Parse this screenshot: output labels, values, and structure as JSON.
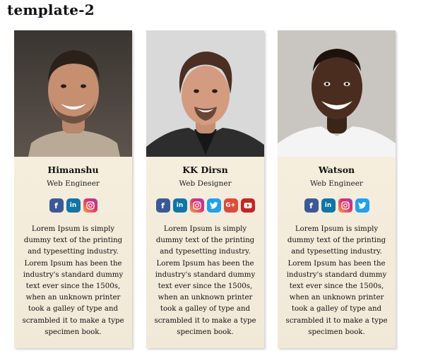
{
  "page": {
    "title": "template-2"
  },
  "cards": [
    {
      "name": "Himanshu",
      "role": "Web Engineer",
      "socials": [
        "facebook-icon",
        "linkedin-icon",
        "instagram-icon"
      ],
      "bio": "Lorem Ipsum is simply dummy text of the printing and typesetting industry. Lorem Ipsum has been the industry's standard dummy text ever since the 1500s, when an unknown printer took a galley of type and scrambled it to make a type specimen book."
    },
    {
      "name": "KK Dirsn",
      "role": "Web Designer",
      "socials": [
        "facebook-icon",
        "linkedin-icon",
        "instagram-icon",
        "twitter-icon",
        "google-plus-icon",
        "youtube-icon"
      ],
      "bio": "Lorem Ipsum is simply dummy text of the printing and typesetting industry. Lorem Ipsum has been the industry's standard dummy text ever since the 1500s, when an unknown printer took a galley of type and scrambled it to make a type specimen book."
    },
    {
      "name": "Watson",
      "role": "Web Engineer",
      "socials": [
        "facebook-icon",
        "linkedin-icon",
        "instagram-icon",
        "twitter-icon"
      ],
      "bio": "Lorem Ipsum is simply dummy text of the printing and typesetting industry. Lorem Ipsum has been the industry's standard dummy text ever since the 1500s, when an unknown printer took a galley of type and scrambled it to make a type specimen book."
    }
  ],
  "colors": {
    "card_background": "#f8f1e0",
    "facebook": "#3b5998",
    "linkedin": "#0e76a8",
    "twitter": "#1da1f2",
    "google_plus": "#dd4b39",
    "youtube": "#cd201f"
  }
}
